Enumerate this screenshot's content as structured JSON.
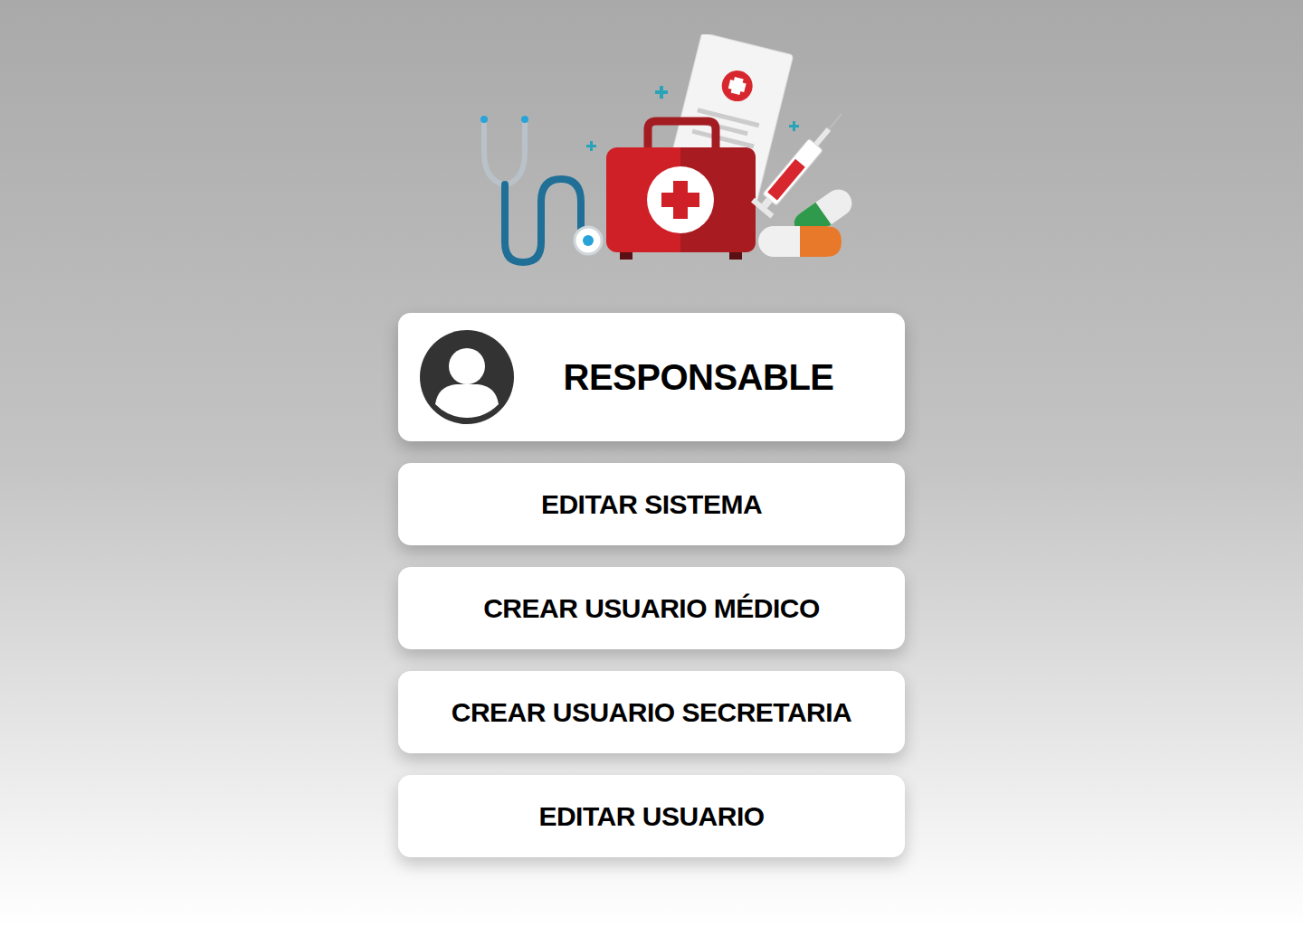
{
  "profile": {
    "title": "RESPONSABLE"
  },
  "menu": [
    {
      "label": "EDITAR SISTEMA"
    },
    {
      "label": "CREAR USUARIO MÉDICO"
    },
    {
      "label": "CREAR USUARIO SECRETARIA"
    },
    {
      "label": "EDITAR USUARIO"
    }
  ]
}
